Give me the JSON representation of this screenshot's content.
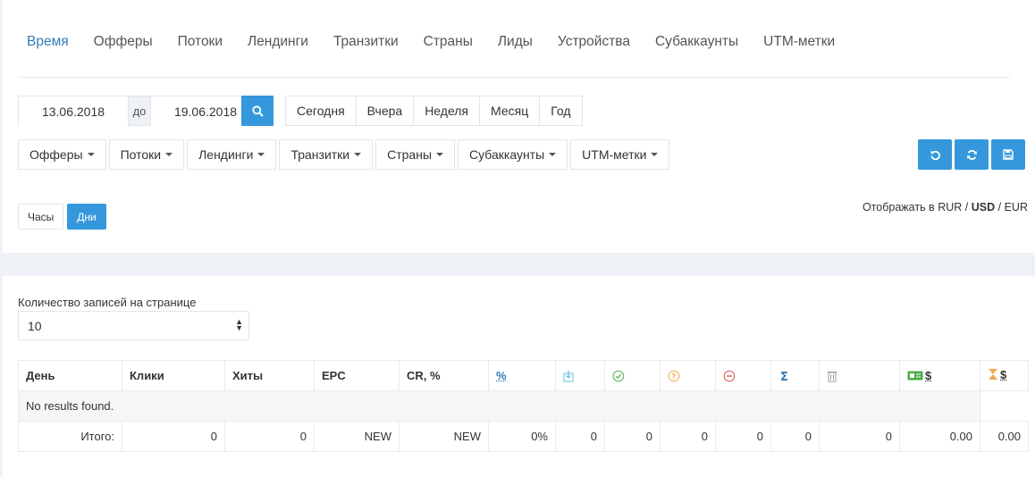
{
  "tabs": [
    "Время",
    "Офферы",
    "Потоки",
    "Лендинги",
    "Транзитки",
    "Страны",
    "Лиды",
    "Устройства",
    "Субаккаунты",
    "UTM-метки"
  ],
  "date_range": {
    "from": "13.06.2018",
    "sep": "до",
    "to": "19.06.2018"
  },
  "periods": [
    "Сегодня",
    "Вчера",
    "Неделя",
    "Месяц",
    "Год"
  ],
  "filters": [
    "Офферы",
    "Потоки",
    "Лендинги",
    "Транзитки",
    "Страны",
    "Субаккаунты",
    "UTM-метки"
  ],
  "granularity": {
    "hours": "Часы",
    "days": "Дни"
  },
  "currency": {
    "prefix": "Отображать в",
    "rur": "RUR",
    "sep1": "/",
    "usd": "USD",
    "sep2": "/",
    "eur": "EUR"
  },
  "page_size": {
    "label": "Количество записей на странице",
    "value": "10"
  },
  "table": {
    "headers": {
      "day": "День",
      "clicks": "Клики",
      "hits": "Хиты",
      "epc": "EPC",
      "cr": "CR, %",
      "pct": "%",
      "money1": "$",
      "money2": "$"
    },
    "empty": "No results found.",
    "totals": {
      "label": "Итого:",
      "clicks": "0",
      "hits": "0",
      "epc": "NEW",
      "cr": "NEW",
      "pct": "0%",
      "c6": "0",
      "c7": "0",
      "c8": "0",
      "c9": "0",
      "c10": "0",
      "c11": "0",
      "m1": "0.00",
      "m2": "0.00"
    }
  },
  "colors": {
    "accent": "#3598dc",
    "link": "#337ab7",
    "green": "#4cae4c",
    "orange": "#f0ad4e",
    "red": "#d9534f",
    "border": "#e7ecf1"
  }
}
